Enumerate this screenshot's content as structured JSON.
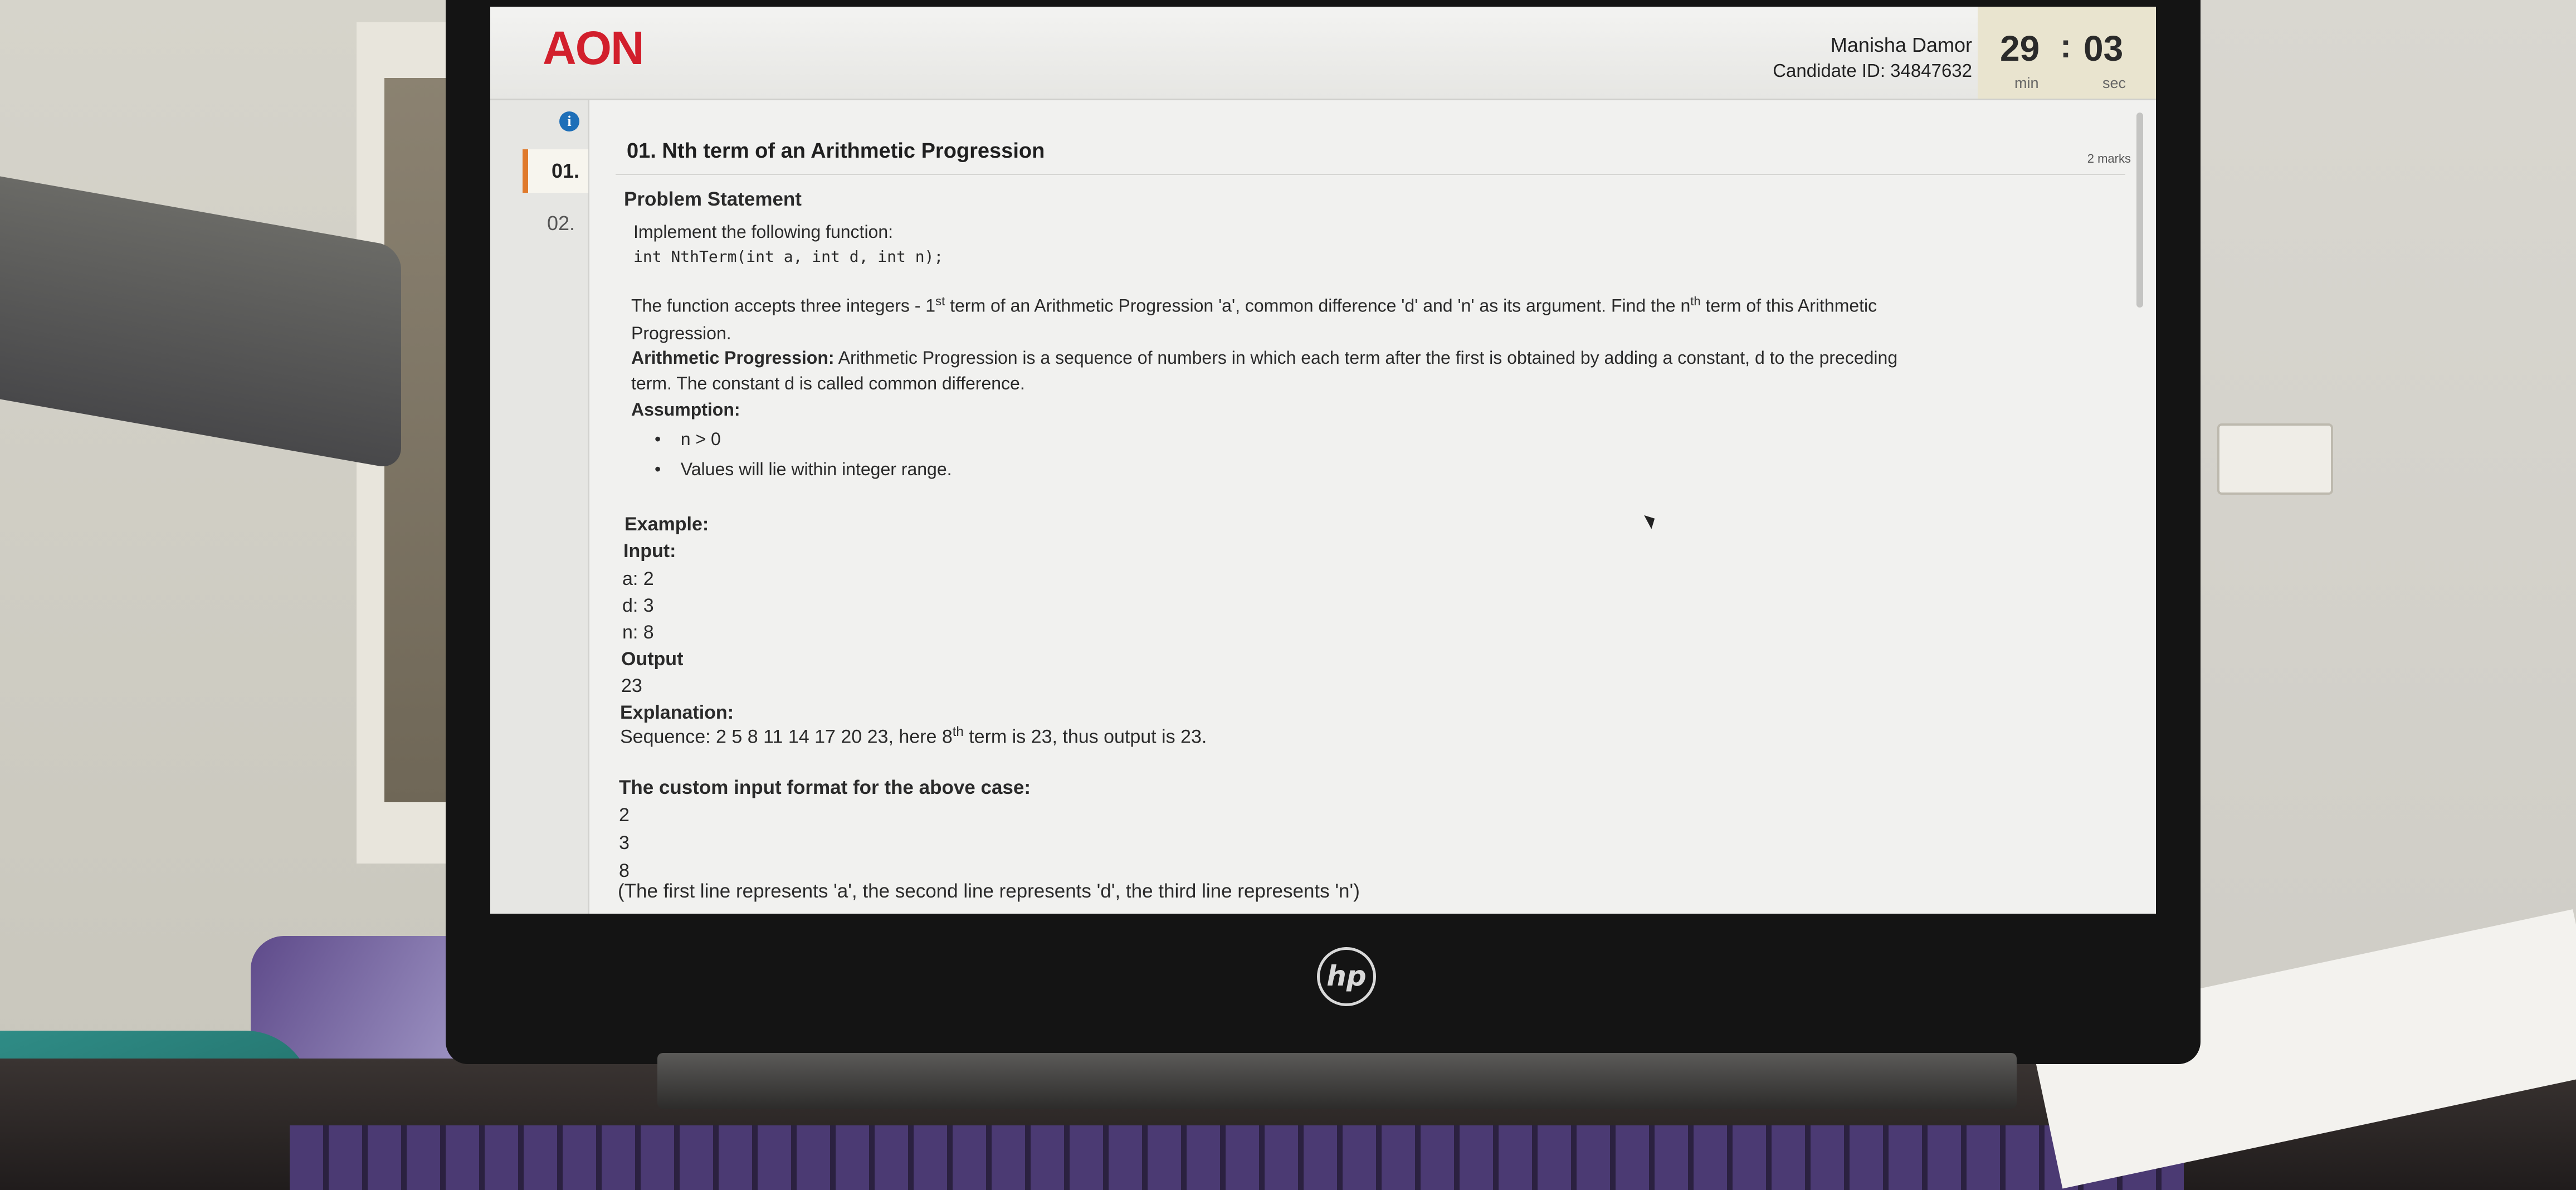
{
  "header": {
    "logo": "AON",
    "candidate_name": "Manisha Damor",
    "candidate_id": "Candidate ID: 34847632",
    "timer_minutes": "29",
    "timer_colon": ":",
    "timer_seconds": "03",
    "timer_min_label": "min",
    "timer_sec_label": "sec"
  },
  "sidebar": {
    "questions": [
      {
        "label": "01.",
        "active": true
      },
      {
        "label": "02.",
        "active": false
      }
    ]
  },
  "question": {
    "title": "01.  Nth term of an Arithmetic Progression",
    "marks": "2 marks",
    "section_heading": "Problem Statement",
    "intro": "Implement the following function:",
    "signature": "int NthTerm(int a, int d, int n);",
    "desc_part1": "The function accepts three integers - 1",
    "desc_sup1": "st",
    "desc_part2": " term of an Arithmetic Progression 'a', common difference 'd' and 'n' as its argument. Find the n",
    "desc_sup2": "th",
    "desc_part3": " term of this Arithmetic",
    "desc_line2": "Progression.",
    "ap_label": "Arithmetic Progression:",
    "ap_text": " Arithmetic Progression is a sequence of numbers in which each term after the first is obtained by adding a constant, d to the preceding",
    "ap_text2": "term. The constant d is called common difference.",
    "assumption_label": "Assumption:",
    "assumptions": [
      "n > 0",
      "Values will lie within integer range."
    ],
    "example_label": "Example:",
    "input_label": "Input:",
    "inputs": [
      "a: 2",
      "d: 3",
      "n: 8"
    ],
    "output_label": "Output",
    "output_value": "23",
    "explanation_label": "Explanation:",
    "explanation_part1": "Sequence: 2 5 8 11 14 17 20 23, here 8",
    "explanation_sup": "th",
    "explanation_part2": " term is 23, thus output is 23.",
    "custom_label": "The custom input format for the above case:",
    "custom_lines": [
      "2",
      "3",
      "8"
    ],
    "custom_note": "(The first line represents 'a', the second line represents 'd', the third line represents 'n')"
  },
  "device": {
    "brand": "hp"
  }
}
